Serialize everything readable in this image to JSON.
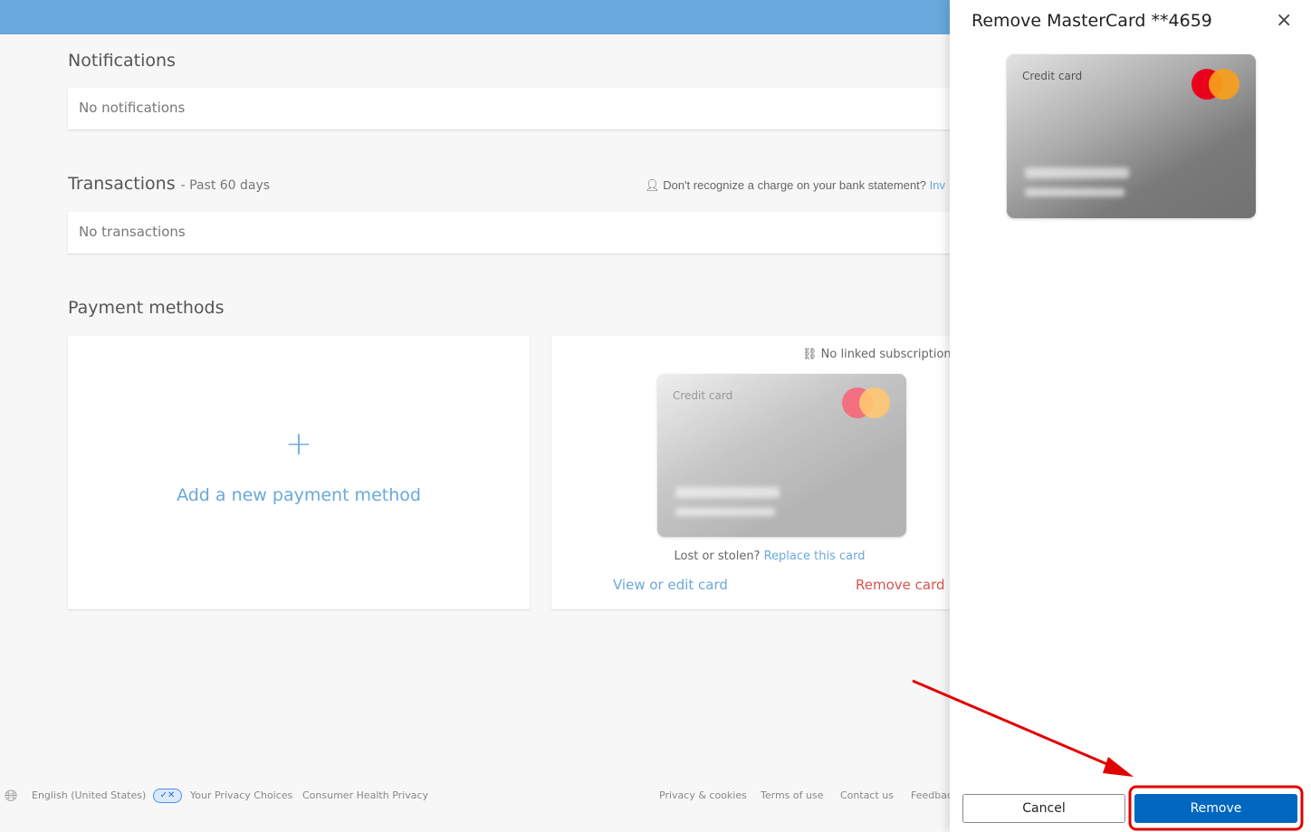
{
  "notifications": {
    "title": "Notifications",
    "empty": "No notifications"
  },
  "transactions": {
    "title": "Transactions",
    "subtitle": "- Past 60 days",
    "question": "Don't recognize a charge on your bank statement?",
    "question_link": "Inv",
    "empty": "No transactions"
  },
  "payment_methods": {
    "title": "Payment methods",
    "add_label": "Add a new payment method",
    "card": {
      "linked": "No linked subscriptions",
      "type_label": "Credit card",
      "lost": "Lost or stolen?",
      "replace": "Replace this card",
      "view_edit": "View or edit card",
      "remove": "Remove card"
    }
  },
  "footer": {
    "language": "English (United States)",
    "privacy_choices": "Your Privacy Choices",
    "consumer_health": "Consumer Health Privacy",
    "links": [
      "Privacy & cookies",
      "Terms of use",
      "Contact us",
      "Feedback"
    ]
  },
  "dialog": {
    "title": "Remove MasterCard **4659",
    "card_label": "Credit card",
    "cancel": "Cancel",
    "remove": "Remove"
  },
  "colors": {
    "accent": "#0067c0",
    "link": "#6aa8dc",
    "danger": "#d9534f",
    "annotation": "#e00000"
  }
}
